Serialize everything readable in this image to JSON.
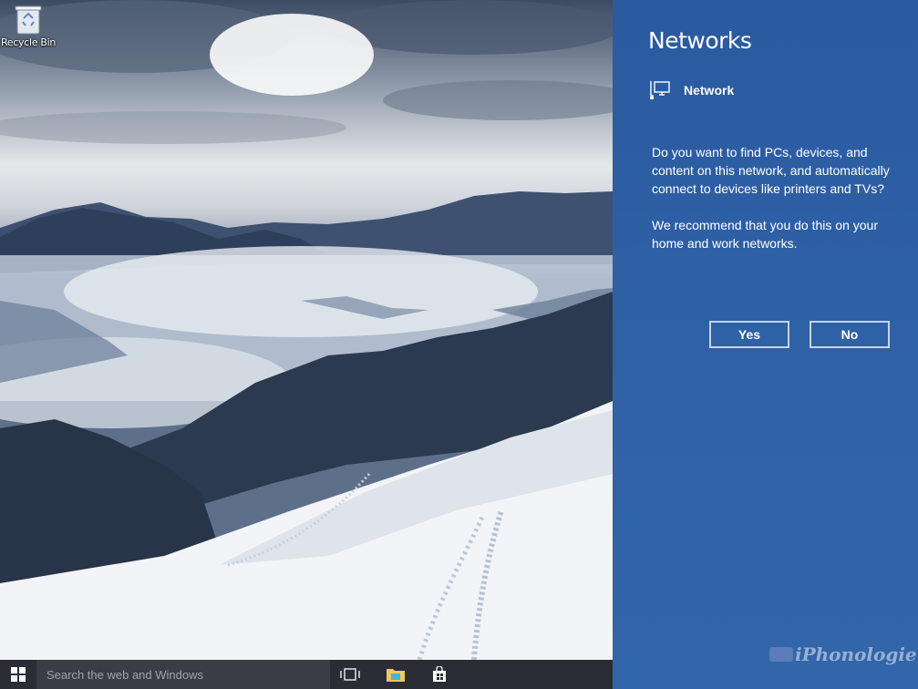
{
  "desktop": {
    "icons": [
      {
        "label": "Recycle Bin",
        "icon": "recycle-bin-icon"
      }
    ]
  },
  "taskbar": {
    "search_placeholder": "Search the web and Windows",
    "icons": [
      "windows-start-icon",
      "task-view-icon",
      "file-explorer-icon",
      "store-icon"
    ]
  },
  "flyout": {
    "title": "Networks",
    "network_name": "Network",
    "network_icon": "network-computer-icon",
    "description_1": "Do you want to find PCs, devices, and content on this network, and automatically connect to devices like printers and TVs?",
    "description_2": "We recommend that you do this on your home and work networks.",
    "yes_label": "Yes",
    "no_label": "No",
    "background_color": "#2e60a6"
  },
  "watermark": {
    "text": "iPhonologie.fr"
  }
}
